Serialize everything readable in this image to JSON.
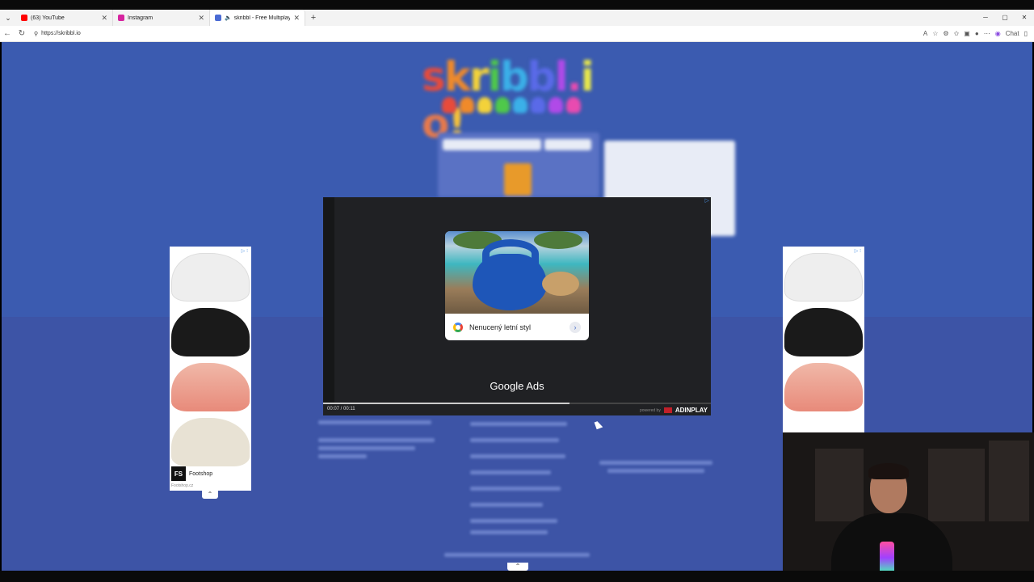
{
  "browser": {
    "tabs": [
      {
        "title": "(63) YouTube",
        "color": "#ff0000"
      },
      {
        "title": "Instagram",
        "color": "#d6249f"
      },
      {
        "title": "skribbl - Free Multiplayer Dra",
        "color": "#4a6bd4"
      }
    ],
    "url": "https://skribbl.io",
    "chat_label": "Chat"
  },
  "player": {
    "ad_text": "Nenucený letní styl",
    "brand": "Google Ads",
    "time": "00:07 / 00:11",
    "progress": 0.636,
    "powered_by": "powered by",
    "network": "ADINPLAY"
  },
  "side_ad_left": {
    "brand_logo": "FS",
    "brand_name": "Footshop",
    "brand_url": "Footshop.cz"
  },
  "colors": {
    "page_bg": "#3d54a6",
    "player_bg": "#202124"
  }
}
